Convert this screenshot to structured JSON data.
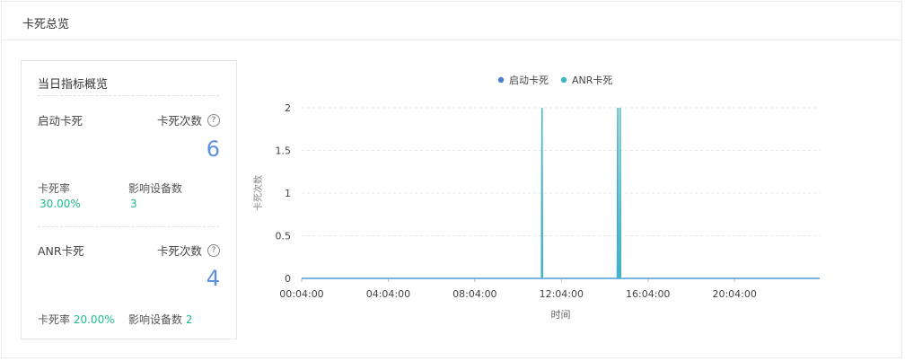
{
  "panel": {
    "title": "卡死总览"
  },
  "overview": {
    "title": "当日指标概览",
    "help_icon": "question-circle-icon",
    "startup": {
      "name": "启动卡死",
      "count_label": "卡死次数",
      "count": "6",
      "rate_label": "卡死率",
      "rate": "30.00%",
      "devices_label": "影响设备数",
      "devices": "3"
    },
    "anr": {
      "name": "ANR卡死",
      "count_label": "卡死次数",
      "count": "4",
      "rate_label": "卡死率",
      "rate": "20.00%",
      "devices_label": "影响设备数",
      "devices": "2"
    }
  },
  "colors": {
    "accent_blue": "#5d8fdf",
    "accent_green": "#1bbf8a",
    "series_startup": "#4a7fd4",
    "series_anr": "#3fb6c6"
  },
  "chart_data": {
    "type": "line",
    "xlabel": "时间",
    "ylabel": "卡死次数",
    "ylim": [
      0,
      2
    ],
    "yticks": [
      "0",
      "0.5",
      "1",
      "1.5",
      "2"
    ],
    "xtick_labels": [
      "00:04:00",
      "04:04:00",
      "08:04:00",
      "12:04:00",
      "16:04:00",
      "20:04:00"
    ],
    "xrange_hours": [
      0.0667,
      24.0
    ],
    "grid": true,
    "legend_position": "top-center",
    "series": [
      {
        "name": "启动卡死",
        "color": "#4a7fd4",
        "spikes": [
          [
            11.17,
            2
          ],
          [
            14.67,
            2
          ],
          [
            14.78,
            2
          ]
        ]
      },
      {
        "name": "ANR卡死",
        "color": "#3fb6c6",
        "spikes": [
          [
            11.17,
            2
          ],
          [
            14.67,
            2
          ],
          [
            14.78,
            2
          ]
        ]
      }
    ]
  }
}
